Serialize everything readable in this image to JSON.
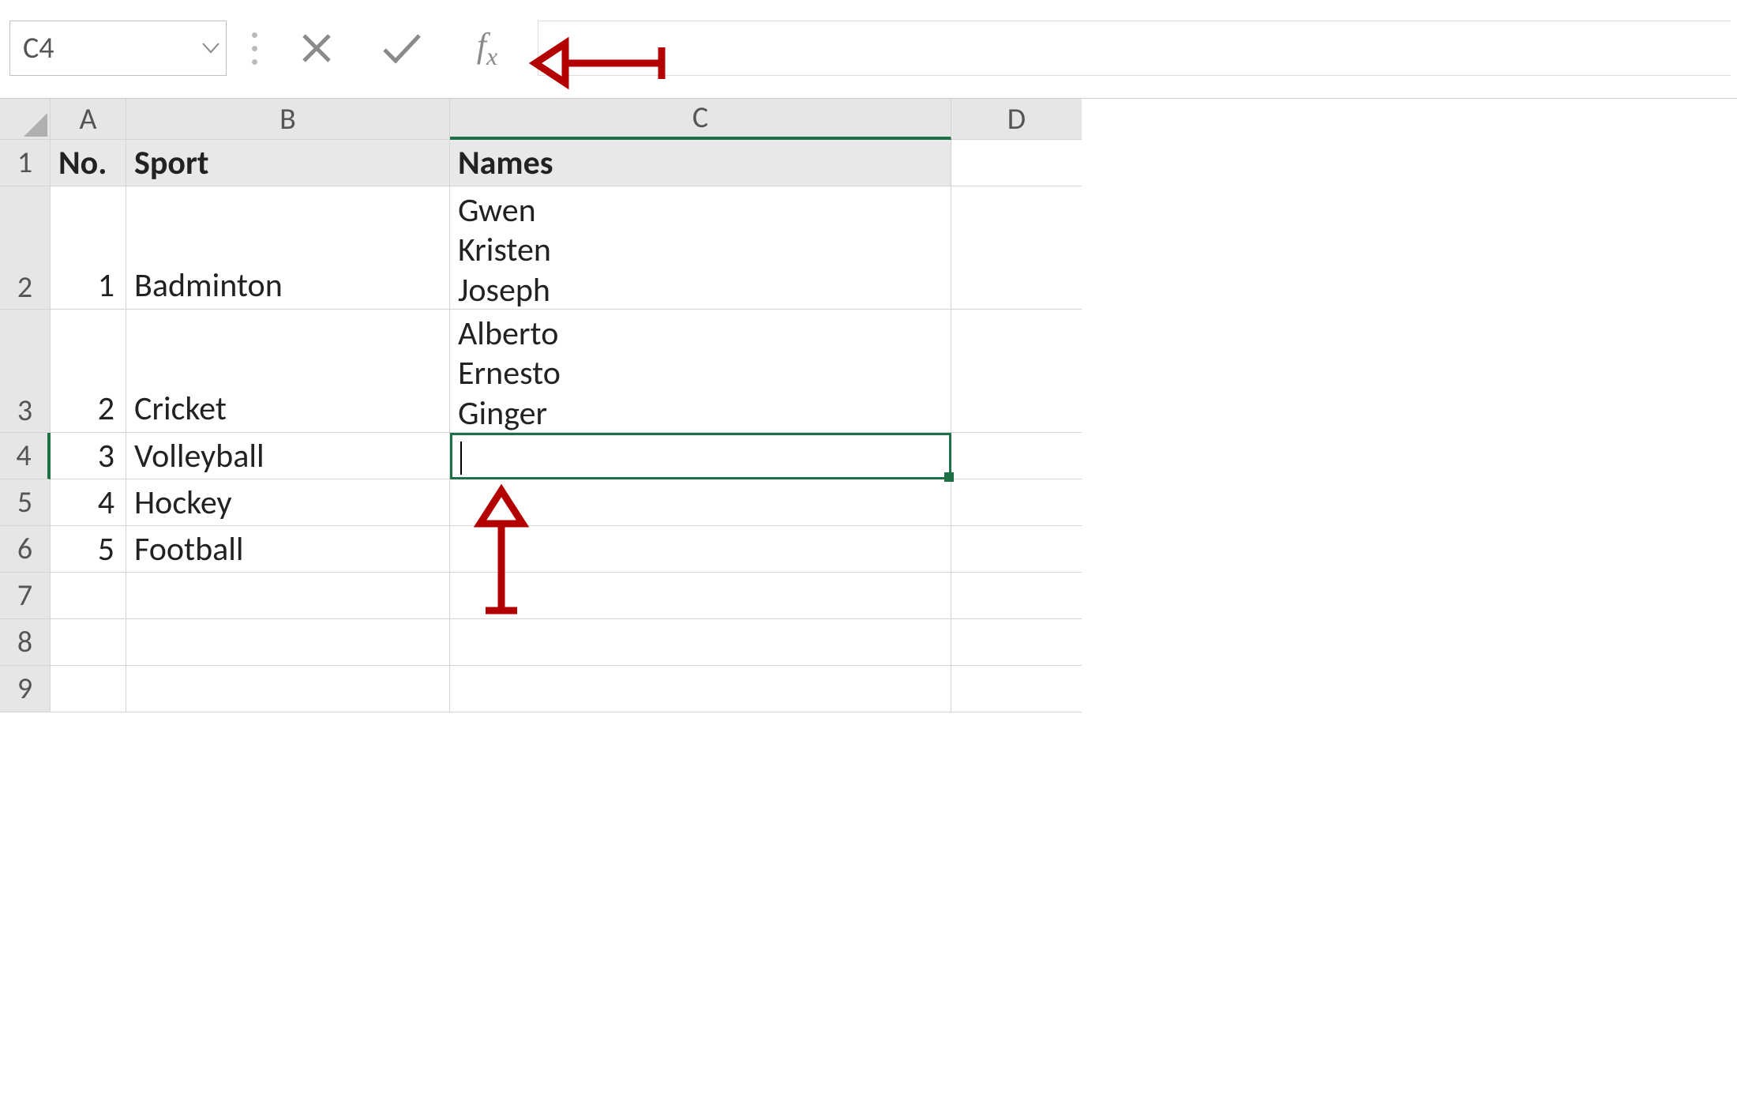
{
  "formula_bar": {
    "name_box_value": "C4",
    "cancel_tooltip": "Cancel",
    "enter_tooltip": "Enter",
    "fx_tooltip": "Insert Function",
    "formula_value": ""
  },
  "columns": [
    "A",
    "B",
    "C",
    "D"
  ],
  "row_numbers": [
    "1",
    "2",
    "3",
    "4",
    "5",
    "6",
    "7",
    "8",
    "9"
  ],
  "headers": {
    "A": "No.",
    "B": "Sport",
    "C": "Names"
  },
  "rows": [
    {
      "no": "1",
      "sport": "Badminton",
      "names": "Gwen\nKristen\nJoseph"
    },
    {
      "no": "2",
      "sport": "Cricket",
      "names": "Alberto\nErnesto\nGinger"
    },
    {
      "no": "3",
      "sport": "Volleyball",
      "names": ""
    },
    {
      "no": "4",
      "sport": "Hockey",
      "names": ""
    },
    {
      "no": "5",
      "sport": "Football",
      "names": ""
    }
  ],
  "active_cell": "C4",
  "colors": {
    "selection_green": "#1e7145",
    "annotation_red": "#b30000"
  }
}
